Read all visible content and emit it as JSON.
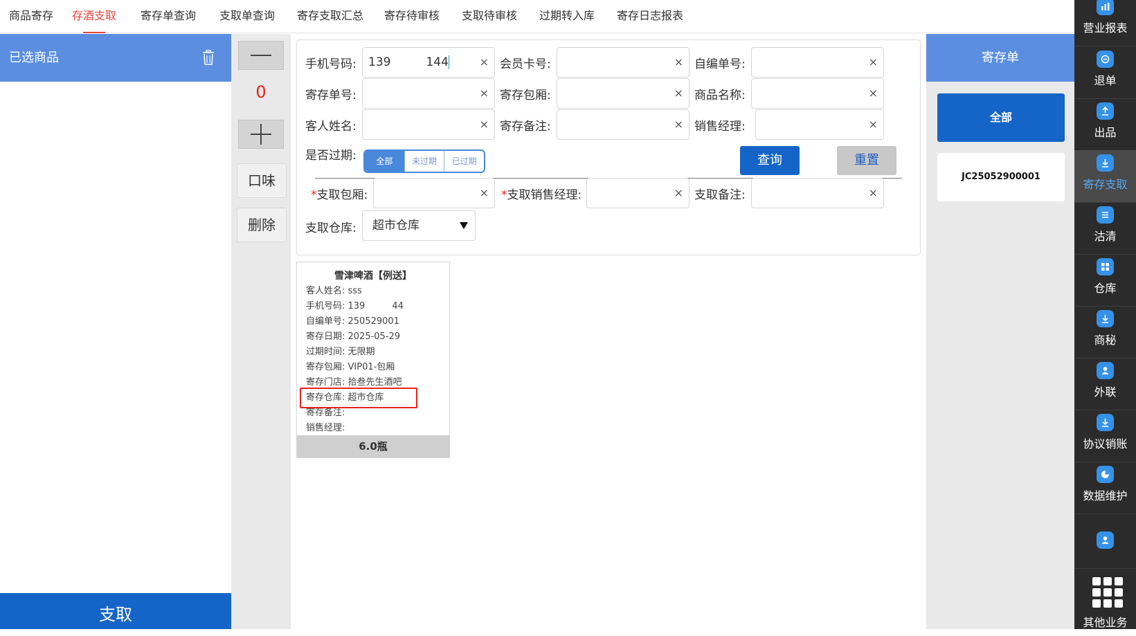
{
  "topnav": {
    "tabs": [
      "商品寄存",
      "存酒支取",
      "寄存单查询",
      "支取单查询",
      "寄存支取汇总",
      "寄存待审核",
      "支取待审核",
      "过期转入库",
      "寄存日志报表"
    ],
    "active": "存酒支取"
  },
  "left": {
    "title": "已选商品",
    "takeout_label": "支取"
  },
  "stepper": {
    "minus": "—",
    "qty": "0",
    "plus": "+",
    "flavor_label": "口味",
    "delete_label": "删除"
  },
  "form": {
    "phone_label": "手机号码:",
    "phone_value": "139      144",
    "member_label": "会员卡号:",
    "selfno_label": "自编单号:",
    "depno_label": "寄存单号:",
    "room_label": "寄存包厢:",
    "goods_label": "商品名称:",
    "guest_label": "客人姓名:",
    "remark_label": "寄存备注:",
    "manager_label": "销售经理:",
    "expired_label": "是否过期:",
    "expired_options": [
      "全部",
      "未过期",
      "已过期"
    ],
    "query_label": "查询",
    "reset_label": "重置",
    "take_room_label": "支取包厢:",
    "take_mgr_label": "支取销售经理:",
    "take_remark_label": "支取备注:",
    "warehouse_label": "支取仓库:",
    "warehouse_value": "超市仓库",
    "clear_icon": "×"
  },
  "card": {
    "title": "雪津啤酒【例送】",
    "rows": [
      "客人姓名: sss",
      "手机号码: 139      44",
      "自编单号: 250529001",
      "寄存日期: 2025-05-29",
      "过期时间: 无限期",
      "寄存包厢: VIP01-包厢",
      "寄存门店: 拾叁先生酒吧",
      "寄存仓库: 超市仓库",
      "寄存备注:",
      "销售经理:"
    ],
    "qty": "6.0瓶"
  },
  "right": {
    "title": "寄存单",
    "all_label": "全部",
    "order_no": "JC25052900001"
  },
  "sidebar": {
    "items": [
      "营业报表",
      "退单",
      "出品",
      "寄存支取",
      "沽清",
      "仓库",
      "商秘",
      "外联",
      "协议销账",
      "数据维护",
      "",
      "其他业务"
    ],
    "active": "寄存支取"
  }
}
